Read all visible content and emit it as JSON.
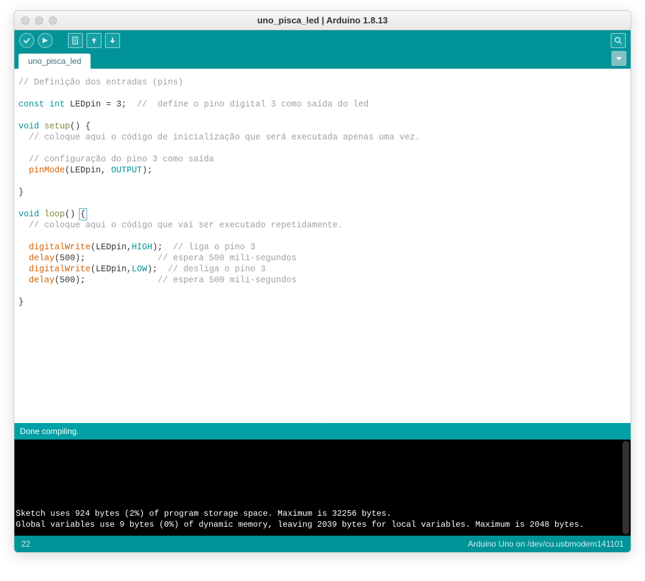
{
  "window": {
    "title": "uno_pisca_led | Arduino 1.8.13"
  },
  "tabs": {
    "active": "uno_pisca_led"
  },
  "code": {
    "lines": [
      {
        "indent": 0,
        "tokens": [
          {
            "t": "comment",
            "v": "// Definição dos entradas (pins)"
          }
        ]
      },
      {
        "indent": 0,
        "tokens": []
      },
      {
        "indent": 0,
        "tokens": [
          {
            "t": "keyword",
            "v": "const"
          },
          {
            "t": "plain",
            "v": " "
          },
          {
            "t": "type",
            "v": "int"
          },
          {
            "t": "plain",
            "v": " LEDpin = 3;  "
          },
          {
            "t": "comment",
            "v": "//  define o pino digital 3 como saída do led"
          }
        ]
      },
      {
        "indent": 0,
        "tokens": []
      },
      {
        "indent": 0,
        "tokens": [
          {
            "t": "type",
            "v": "void"
          },
          {
            "t": "plain",
            "v": " "
          },
          {
            "t": "ufunc",
            "v": "setup"
          },
          {
            "t": "plain",
            "v": "() {"
          }
        ]
      },
      {
        "indent": 1,
        "tokens": [
          {
            "t": "comment",
            "v": "// coloque aqui o código de inicialização que será executada apenas uma vez."
          }
        ]
      },
      {
        "indent": 0,
        "tokens": []
      },
      {
        "indent": 1,
        "tokens": [
          {
            "t": "comment",
            "v": "// configuração do pino 3 como saída"
          }
        ]
      },
      {
        "indent": 1,
        "tokens": [
          {
            "t": "func",
            "v": "pinMode"
          },
          {
            "t": "plain",
            "v": "(LEDpin, "
          },
          {
            "t": "const",
            "v": "OUTPUT"
          },
          {
            "t": "plain",
            "v": ");"
          }
        ]
      },
      {
        "indent": 0,
        "tokens": []
      },
      {
        "indent": 0,
        "tokens": [
          {
            "t": "plain",
            "v": "}"
          }
        ]
      },
      {
        "indent": 0,
        "tokens": []
      },
      {
        "indent": 0,
        "tokens": [
          {
            "t": "type",
            "v": "void"
          },
          {
            "t": "plain",
            "v": " "
          },
          {
            "t": "ufunc",
            "v": "loop"
          },
          {
            "t": "plain",
            "v": "() "
          },
          {
            "t": "cursorbox",
            "v": "{"
          }
        ]
      },
      {
        "indent": 1,
        "tokens": [
          {
            "t": "comment",
            "v": "// coloque aqui o código que vai ser executado repetidamente."
          }
        ]
      },
      {
        "indent": 0,
        "tokens": []
      },
      {
        "indent": 1,
        "tokens": [
          {
            "t": "func",
            "v": "digitalWrite"
          },
          {
            "t": "plain",
            "v": "(LEDpin,"
          },
          {
            "t": "const",
            "v": "HIGH"
          },
          {
            "t": "plain",
            "v": ");  "
          },
          {
            "t": "comment",
            "v": "// liga o pino 3"
          }
        ]
      },
      {
        "indent": 1,
        "tokens": [
          {
            "t": "func",
            "v": "delay"
          },
          {
            "t": "plain",
            "v": "(500);              "
          },
          {
            "t": "comment",
            "v": "// espera 500 mili-segundos"
          }
        ]
      },
      {
        "indent": 1,
        "tokens": [
          {
            "t": "func",
            "v": "digitalWrite"
          },
          {
            "t": "plain",
            "v": "(LEDpin,"
          },
          {
            "t": "const",
            "v": "LOW"
          },
          {
            "t": "plain",
            "v": ");  "
          },
          {
            "t": "comment",
            "v": "// desliga o pino 3"
          }
        ]
      },
      {
        "indent": 1,
        "tokens": [
          {
            "t": "func",
            "v": "delay"
          },
          {
            "t": "plain",
            "v": "(500);              "
          },
          {
            "t": "comment",
            "v": "// espera 500 mili-segundos"
          }
        ]
      },
      {
        "indent": 0,
        "tokens": []
      },
      {
        "indent": 0,
        "tokens": [
          {
            "t": "plain",
            "v": "}"
          }
        ]
      }
    ]
  },
  "status": {
    "message": "Done compiling."
  },
  "console": {
    "lines": [
      "",
      "",
      "",
      "",
      "",
      "",
      "Sketch uses 924 bytes (2%) of program storage space. Maximum is 32256 bytes.",
      "Global variables use 9 bytes (0%) of dynamic memory, leaving 2039 bytes for local variables. Maximum is 2048 bytes."
    ]
  },
  "footer": {
    "line": "22",
    "board": "Arduino Uno on /dev/cu.usbmodem141101"
  }
}
